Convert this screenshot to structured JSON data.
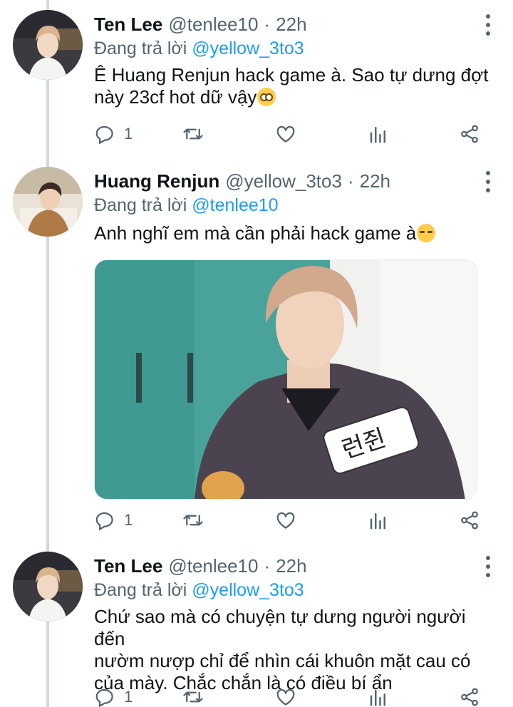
{
  "tweets": [
    {
      "name": "Ten Lee",
      "handle": "@tenlee10",
      "dot": "·",
      "time": "22h",
      "replying_prefix": "Đang trả lời ",
      "replying_to": "@yellow_3to3",
      "text": "Ê Huang Renjun hack game à. Sao tự dưng đợt\nnày 23cf hot dữ vậy",
      "emoji": "flushed-face-emoji",
      "actions": {
        "reply_count": "1",
        "retweet_count": "",
        "like_count": ""
      }
    },
    {
      "name": "Huang Renjun",
      "handle": "@yellow_3to3",
      "dot": "·",
      "time": "22h",
      "replying_prefix": "Đang trả lời ",
      "replying_to": "@tenlee10",
      "text": "Anh nghĩ em mà cần phải hack game à",
      "emoji": "smirking-face-emoji",
      "media_label": "런쥔",
      "actions": {
        "reply_count": "1",
        "retweet_count": "",
        "like_count": ""
      }
    },
    {
      "name": "Ten Lee",
      "handle": "@tenlee10",
      "dot": "·",
      "time": "22h",
      "replying_prefix": "Đang trả lời ",
      "replying_to": "@yellow_3to3",
      "text": "Chứ sao mà có chuyện tự dưng người người đến\nnườm nượp chỉ để nhìn cái khuôn mặt cau có\ncủa mày. Chắc chắn là có điều bí ẩn",
      "actions": {
        "reply_count": "1",
        "retweet_count": "",
        "like_count": ""
      }
    }
  ],
  "icons": {
    "reply": "reply-icon",
    "retweet": "retweet-icon",
    "like": "like-icon",
    "views": "views-icon",
    "share": "share-icon",
    "more": "more-options-icon"
  },
  "colors": {
    "link": "#1d9bf0",
    "secondary": "#536471",
    "thread_line": "#cfd9de"
  }
}
